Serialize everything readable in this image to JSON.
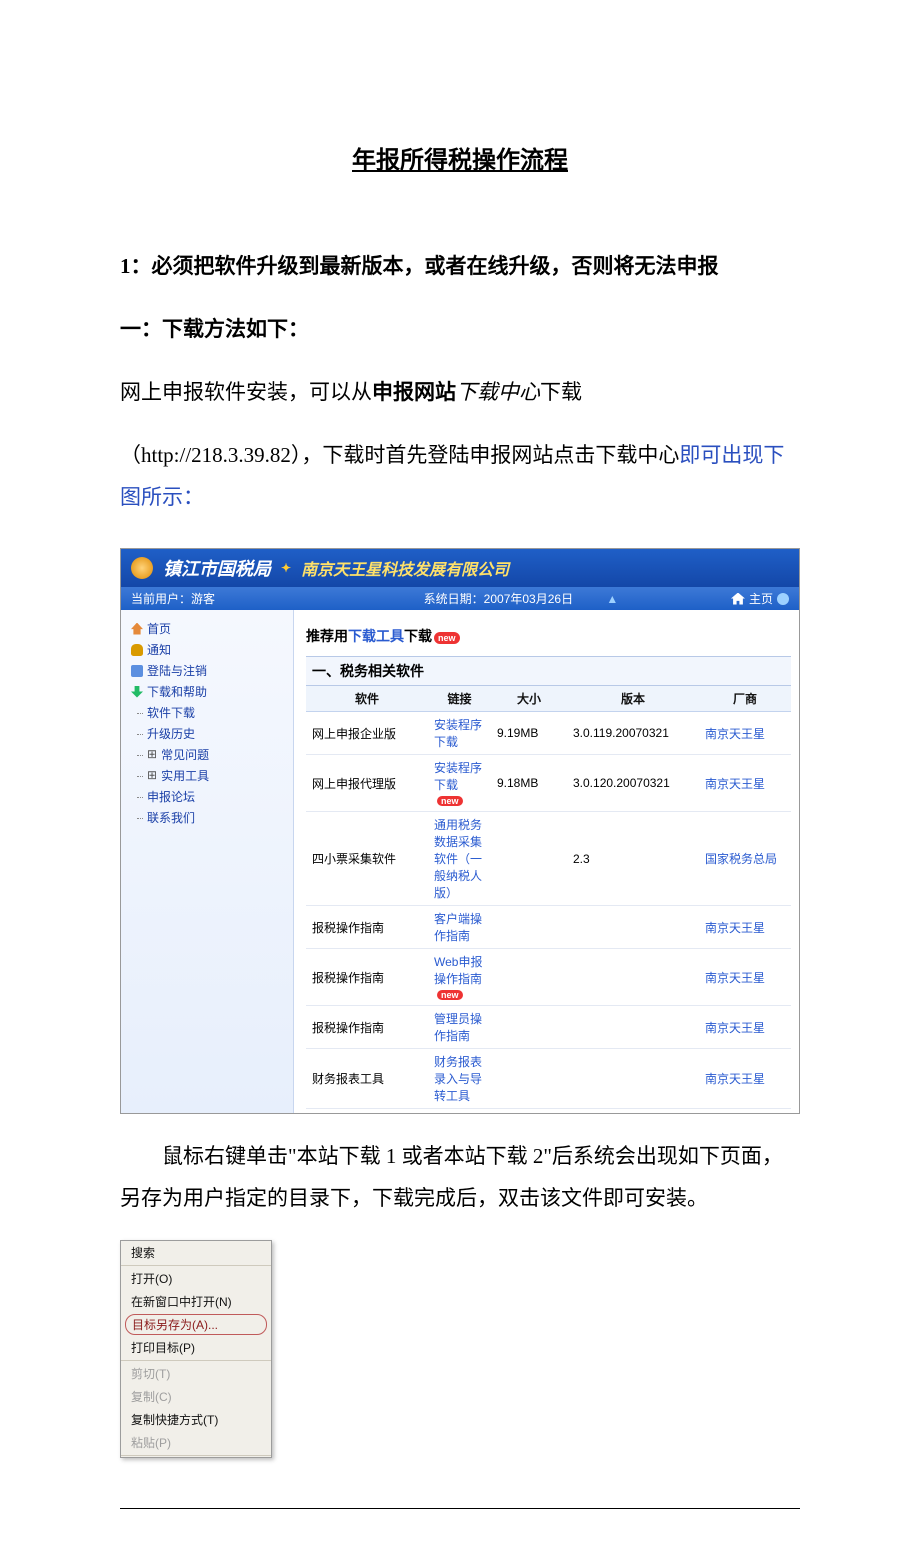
{
  "doc": {
    "title": "年报所得税操作流程",
    "p1_lead": "1：",
    "p1_rest": "必须把软件升级到最新版本，或者在线升级，否则将无法申报",
    "p2": "一：下载方法如下：",
    "p3_a": "网上申报软件安装，可以从",
    "p3_b": "申报网站",
    "p3_c": "下载中心",
    "p3_d": "下载",
    "p4_a": "（http://218.3.39.82），下载时首先登陆申报网站点击下载中心",
    "p4_b": "即可出现",
    "p4_c": "下图所示：",
    "p5": "鼠标右键单击\"本站下载 1 或者本站下载 2\"后系统会出现如下页面，另存为用户指定的目录下，下载完成后，双击该文件即可安装。"
  },
  "shot1": {
    "org1": "镇江市国税局",
    "org2": "南京天王星科技发展有限公司",
    "curUserLabel": "当前用户：游客",
    "sysDate": "系统日期：2007年03月26日",
    "homeBtn": "主页",
    "side": {
      "home": "首页",
      "notice": "通知",
      "login": "登陆与注销",
      "dlhelp": "下载和帮助",
      "swdl": "软件下载",
      "history": "升级历史",
      "faq": "常见问题",
      "tools": "实用工具",
      "forum": "申报论坛",
      "contact": "联系我们"
    },
    "recommend_a": "推荐用",
    "recommend_b": "下载工具",
    "recommend_c": "下载",
    "recommend_new": "new",
    "section": "一、税务相关软件",
    "th": {
      "c1": "软件",
      "c2": "链接",
      "c3": "大小",
      "c4": "版本",
      "c5": "厂商"
    },
    "rows": [
      {
        "c1": "网上申报企业版",
        "c2": "安装程序下载",
        "new": false,
        "c3": "9.19MB",
        "c4": "3.0.119.20070321",
        "c5": "南京天王星"
      },
      {
        "c1": "网上申报代理版",
        "c2": "安装程序下载",
        "new": true,
        "c3": "9.18MB",
        "c4": "3.0.120.20070321",
        "c5": "南京天王星"
      },
      {
        "c1": "四小票采集软件",
        "c2": "通用税务数据采集软件（一般纳税人版）",
        "new": false,
        "c3": "",
        "c4": "2.3",
        "c5": "国家税务总局"
      },
      {
        "c1": "报税操作指南",
        "c2": "客户端操作指南",
        "new": false,
        "c3": "",
        "c4": "",
        "c5": "南京天王星"
      },
      {
        "c1": "报税操作指南",
        "c2": "Web申报操作指南",
        "new": true,
        "c3": "",
        "c4": "",
        "c5": "南京天王星"
      },
      {
        "c1": "报税操作指南",
        "c2": "管理员操作指南",
        "new": false,
        "c3": "",
        "c4": "",
        "c5": "南京天王星"
      },
      {
        "c1": "财务报表工具",
        "c2": "财务报表录入与导转工具",
        "new": false,
        "c3": "",
        "c4": "",
        "c5": "南京天王星"
      }
    ]
  },
  "shot2": {
    "search": "搜索",
    "open": "打开(O)",
    "openNew": "在新窗口中打开(N)",
    "saveTarget": "目标另存为(A)...",
    "printTarget": "打印目标(P)",
    "cut": "剪切(T)",
    "copy": "复制(C)",
    "copyShortcut": "复制快捷方式(T)",
    "paste": "粘贴(P)"
  }
}
